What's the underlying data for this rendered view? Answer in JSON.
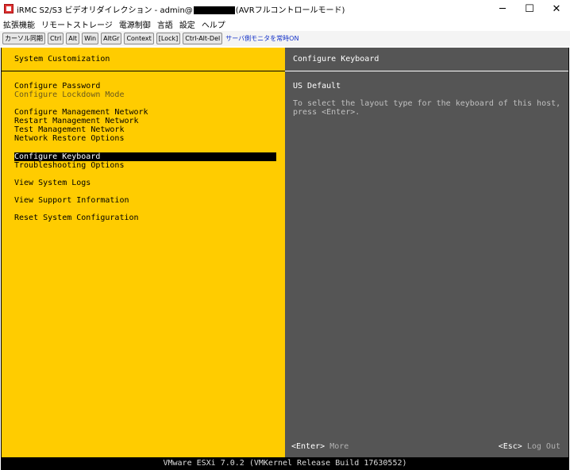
{
  "window": {
    "title_prefix": "iRMC S2/S3 ビデオリダイレクション - admin@",
    "title_suffix": "(AVRフルコントロールモード)",
    "minimize": "─",
    "maximize": "☐",
    "close": "✕"
  },
  "menubar": [
    "拡張機能",
    "リモートストレージ",
    "電源制御",
    "言語",
    "設定",
    "ヘルプ"
  ],
  "toolbar": {
    "buttons": [
      "カーソル同期",
      "Ctrl",
      "Alt",
      "Win",
      "AltGr",
      "Context",
      "[Lock]",
      "Ctrl-Alt-Del"
    ],
    "status_link": "サーバ側モニタを常時ON"
  },
  "left_panel": {
    "title": "System Customization",
    "items": [
      "Configure Password",
      "Configure Lockdown Mode",
      "Configure Management Network",
      "Restart Management Network",
      "Test Management Network",
      "Network Restore Options",
      "Configure Keyboard",
      "Troubleshooting Options",
      "View System Logs",
      "View Support Information",
      "Reset System Configuration"
    ]
  },
  "right_panel": {
    "title": "Configure Keyboard",
    "value": "US Default",
    "description_line1": "To select the layout type for the keyboard of this host,",
    "description_line2": "press <Enter>.",
    "enter_key": "<Enter>",
    "enter_action": "More",
    "esc_key": "<Esc>",
    "esc_action": "Log Out"
  },
  "status_bar": "VMware ESXi 7.0.2 (VMKernel Release Build 17630552)",
  "colors": {
    "left_panel_bg": "#ffcc00",
    "right_panel_bg": "#555555",
    "status_link": "#1432c8"
  }
}
